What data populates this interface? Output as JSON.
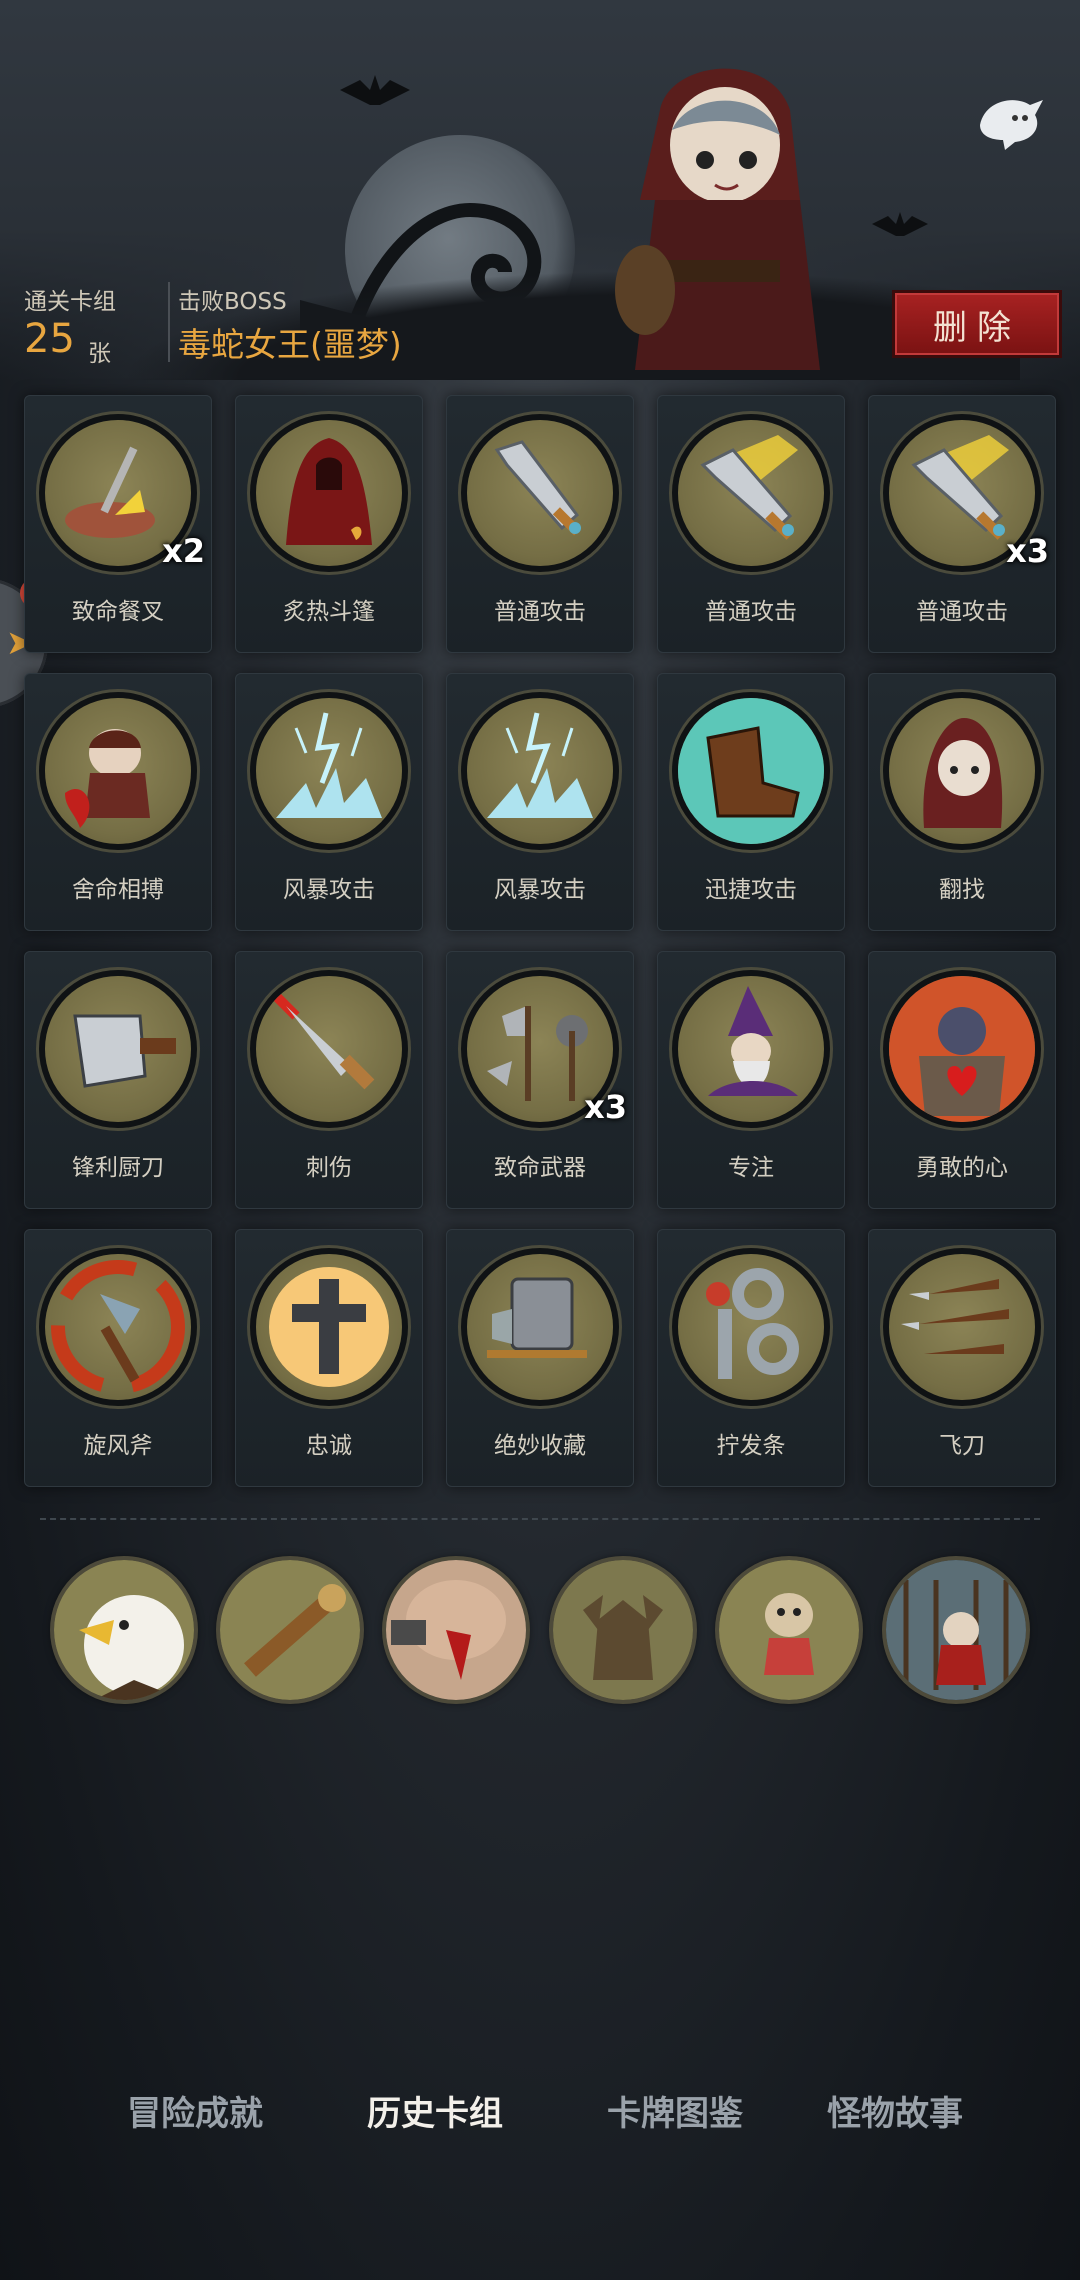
{
  "header": {
    "cleared_deck_label": "通关卡组",
    "card_count": "25",
    "card_unit": "张",
    "boss_label": "击败BOSS",
    "boss_name": "毒蛇女王(噩梦)",
    "delete_label": "删除",
    "back_icon": "ghost-icon"
  },
  "cards": [
    {
      "name": "致命餐叉",
      "count": "x2",
      "icon": "fork-steak-icon"
    },
    {
      "name": "炙热斗篷",
      "count": "",
      "icon": "red-cloak-icon"
    },
    {
      "name": "普通攻击",
      "count": "",
      "icon": "sword-icon"
    },
    {
      "name": "普通攻击",
      "count": "",
      "icon": "flaming-sword-icon"
    },
    {
      "name": "普通攻击",
      "count": "x3",
      "icon": "flaming-sword-icon"
    },
    {
      "name": "舍命相搏",
      "count": "",
      "icon": "desperate-girl-icon"
    },
    {
      "name": "风暴攻击",
      "count": "",
      "icon": "lightning-icon"
    },
    {
      "name": "风暴攻击",
      "count": "",
      "icon": "lightning-icon"
    },
    {
      "name": "迅捷攻击",
      "count": "",
      "icon": "swift-boot-icon"
    },
    {
      "name": "翻找",
      "count": "",
      "icon": "hooded-girl-icon"
    },
    {
      "name": "锋利厨刀",
      "count": "",
      "icon": "cleaver-icon"
    },
    {
      "name": "刺伤",
      "count": "",
      "icon": "dagger-icon"
    },
    {
      "name": "致命武器",
      "count": "x3",
      "icon": "weapons-icon"
    },
    {
      "name": "专注",
      "count": "",
      "icon": "wizard-icon"
    },
    {
      "name": "勇敢的心",
      "count": "",
      "icon": "brave-heart-icon"
    },
    {
      "name": "旋风斧",
      "count": "",
      "icon": "whirlwind-axe-icon"
    },
    {
      "name": "忠诚",
      "count": "",
      "icon": "holy-cross-icon"
    },
    {
      "name": "绝妙收藏",
      "count": "",
      "icon": "collection-icon"
    },
    {
      "name": "拧发条",
      "count": "",
      "icon": "wind-up-key-icon"
    },
    {
      "name": "飞刀",
      "count": "",
      "icon": "throwing-knives-icon"
    }
  ],
  "relics": [
    {
      "icon": "eagle-icon"
    },
    {
      "icon": "spyglass-icon"
    },
    {
      "icon": "bloody-fist-icon"
    },
    {
      "icon": "gargoyle-statue-icon"
    },
    {
      "icon": "voodoo-doll-icon"
    },
    {
      "icon": "caged-girl-icon"
    }
  ],
  "bottom_nav": {
    "tabs": [
      {
        "label": "冒险成就",
        "active": false
      },
      {
        "label": "历史卡组",
        "active": true
      },
      {
        "label": "卡牌图鉴",
        "active": false
      },
      {
        "label": "怪物故事",
        "active": false
      }
    ]
  },
  "colors": {
    "accent": "#e8a640",
    "delete_bg": "#a82222",
    "card_bg": "#1e252a",
    "icon_disc": "#7d764a"
  }
}
